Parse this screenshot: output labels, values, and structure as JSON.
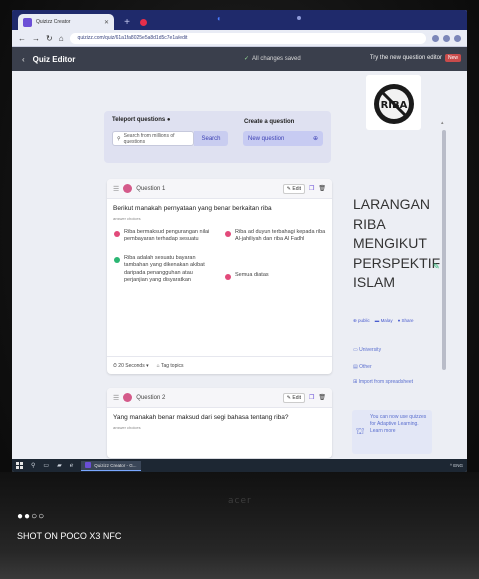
{
  "browser": {
    "tab_title": "Quizizz Creator",
    "url": "quizizz.com/quiz/61a1fa8025e5a8d1d5c7e1a/edit"
  },
  "app": {
    "title": "Quiz Editor",
    "saved_status": "All changes saved",
    "try_new": "Try the new question editor",
    "new_badge": "New"
  },
  "teleport": {
    "label": "Teleport questions",
    "search_placeholder": "Search from millions of questions",
    "search_button": "Search"
  },
  "create": {
    "label": "Create a question",
    "select_value": "New question"
  },
  "questions": [
    {
      "label": "Question 1",
      "text": "Berikut manakah pernyataan yang benar berkaitan riba",
      "answer_label": "answer choices",
      "options": [
        {
          "text": "Riba bermaksud pengurangan nilai pembayaran terhadap sesuatu",
          "correct": false
        },
        {
          "text": "Riba ad duyun terbahagi kepada riba Al-jahiliyah dan riba Al Fadhl",
          "correct": false
        },
        {
          "text": "Riba adalah sesuatu bayaran tambahan yang dikenakan akibat daripada penangguhan atau perjanjian yang disyaratkan",
          "correct": true
        },
        {
          "text": "Semua diatas",
          "correct": false
        }
      ],
      "time": "20 Seconds",
      "tag": "Tag topics"
    },
    {
      "label": "Question 2",
      "text": "Yang manakah benar maksud dari segi bahasa tentang riba?",
      "answer_label": "answer choices"
    }
  ],
  "buttons": {
    "edit": "Edit"
  },
  "quiz": {
    "image_text": "RIBA",
    "title": "LARANGAN RIBA MENGIKUT PERSPEKTIF ISLAM",
    "meta": [
      "public",
      "Malay",
      "Share"
    ],
    "grade": "University",
    "subject": "Other",
    "import": "Import from spreadsheet",
    "adaptive": "You can now use quizzes for Adaptive Learning. Learn more"
  },
  "taskbar": {
    "task_label": "Quizizz Creator - G...",
    "tray": "^ ENG"
  },
  "photo": {
    "brand": "acer",
    "watermark_dots": "●●○○",
    "watermark": "SHOT ON POCO X3 NFC"
  },
  "colors": {
    "accent": "#5d3fd3",
    "correct": "#2bb673",
    "wrong": "#e24a7a",
    "header": "#3a3f4c"
  }
}
